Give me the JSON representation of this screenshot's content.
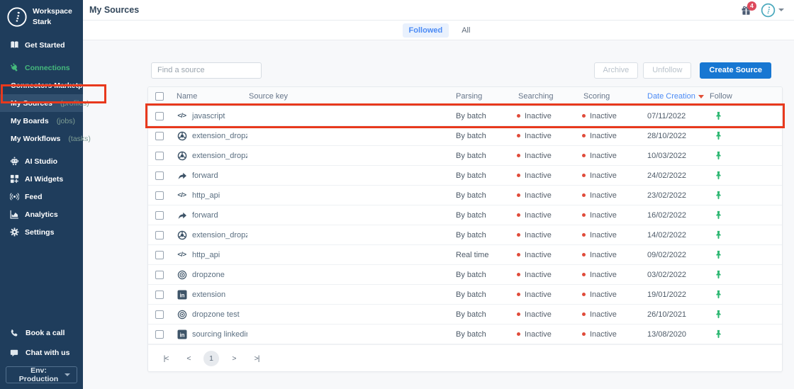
{
  "sidebar": {
    "workspace": {
      "line1": "Workspace",
      "line2": "Stark"
    },
    "items": [
      {
        "label": "Get Started",
        "icon": "book"
      },
      {
        "label": "Connections",
        "icon": "plug",
        "active": true
      },
      {
        "label": "Connectors Marketplace",
        "sub": true
      },
      {
        "label": "My Sources",
        "suffix": "(profiles)",
        "sub": true,
        "selected": true
      },
      {
        "label": "My Boards",
        "suffix": "(jobs)",
        "sub": true
      },
      {
        "label": "My Workflows",
        "suffix": "(tasks)",
        "sub": true
      },
      {
        "label": "AI Studio",
        "icon": "robot"
      },
      {
        "label": "AI Widgets",
        "icon": "widget"
      },
      {
        "label": "Feed",
        "icon": "feed"
      },
      {
        "label": "Analytics",
        "icon": "chart"
      },
      {
        "label": "Settings",
        "icon": "gear"
      }
    ],
    "footer": [
      {
        "label": "Book a call",
        "icon": "phone"
      },
      {
        "label": "Chat with us",
        "icon": "chat"
      }
    ],
    "env_label": "Env: Production"
  },
  "header": {
    "title": "My Sources",
    "notifications_count": "4"
  },
  "tabs": [
    {
      "label": "Followed",
      "active": true
    },
    {
      "label": "All",
      "active": false
    }
  ],
  "toolbar": {
    "search_placeholder": "Find a source",
    "archive_label": "Archive",
    "unfollow_label": "Unfollow",
    "create_label": "Create Source"
  },
  "table": {
    "columns": [
      {
        "label": "Name"
      },
      {
        "label": "Source key"
      },
      {
        "label": "Parsing"
      },
      {
        "label": "Searching"
      },
      {
        "label": "Scoring"
      },
      {
        "label": "Date Creation",
        "sorted": "desc"
      },
      {
        "label": "Follow"
      }
    ],
    "source_keys_visible": false,
    "rows": [
      {
        "name": "javascript",
        "icon": "code",
        "parsing": "By batch",
        "searching": "Inactive",
        "scoring": "Inactive",
        "date": "07/11/2022",
        "followed": true,
        "annotated": true
      },
      {
        "name": "extension_dropzone",
        "icon": "chrome",
        "parsing": "By batch",
        "searching": "Inactive",
        "scoring": "Inactive",
        "date": "28/10/2022",
        "followed": true
      },
      {
        "name": "extension_dropzone",
        "icon": "chrome",
        "parsing": "By batch",
        "searching": "Inactive",
        "scoring": "Inactive",
        "date": "10/03/2022",
        "followed": true
      },
      {
        "name": "forward",
        "icon": "forward",
        "parsing": "By batch",
        "searching": "Inactive",
        "scoring": "Inactive",
        "date": "24/02/2022",
        "followed": true
      },
      {
        "name": "http_api",
        "icon": "code",
        "parsing": "By batch",
        "searching": "Inactive",
        "scoring": "Inactive",
        "date": "23/02/2022",
        "followed": true
      },
      {
        "name": "forward",
        "icon": "forward",
        "parsing": "By batch",
        "searching": "Inactive",
        "scoring": "Inactive",
        "date": "16/02/2022",
        "followed": true
      },
      {
        "name": "extension_dropzone",
        "icon": "chrome",
        "parsing": "By batch",
        "searching": "Inactive",
        "scoring": "Inactive",
        "date": "14/02/2022",
        "followed": true
      },
      {
        "name": "http_api",
        "icon": "code",
        "parsing": "Real time",
        "searching": "Inactive",
        "scoring": "Inactive",
        "date": "09/02/2022",
        "followed": true
      },
      {
        "name": "dropzone",
        "icon": "target",
        "parsing": "By batch",
        "searching": "Inactive",
        "scoring": "Inactive",
        "date": "03/02/2022",
        "followed": true
      },
      {
        "name": "extension",
        "icon": "linkedin",
        "parsing": "By batch",
        "searching": "Inactive",
        "scoring": "Inactive",
        "date": "19/01/2022",
        "followed": true
      },
      {
        "name": "dropzone test",
        "icon": "target",
        "parsing": "By batch",
        "searching": "Inactive",
        "scoring": "Inactive",
        "date": "26/10/2021",
        "followed": true
      },
      {
        "name": "sourcing linkedin",
        "icon": "linkedin",
        "parsing": "By batch",
        "searching": "Inactive",
        "scoring": "Inactive",
        "date": "13/08/2020",
        "followed": true
      }
    ]
  },
  "pagination": {
    "buttons": [
      {
        "name": "first",
        "label": "|<"
      },
      {
        "name": "prev",
        "label": "<"
      },
      {
        "name": "page-1",
        "label": "1",
        "current": true
      },
      {
        "name": "next",
        "label": ">"
      },
      {
        "name": "last",
        "label": ">|"
      }
    ]
  },
  "colors": {
    "accent_blue": "#4c8bf5",
    "primary_btn": "#1777d2",
    "sidebar_bg": "#1f3d5c",
    "green": "#45b97c",
    "status_red": "#e04b3a",
    "pin_green": "#2eb873",
    "badge_red": "#dd4a5c",
    "annotation_red": "#e8391d",
    "avatar_teal": "#4aa9bd"
  }
}
